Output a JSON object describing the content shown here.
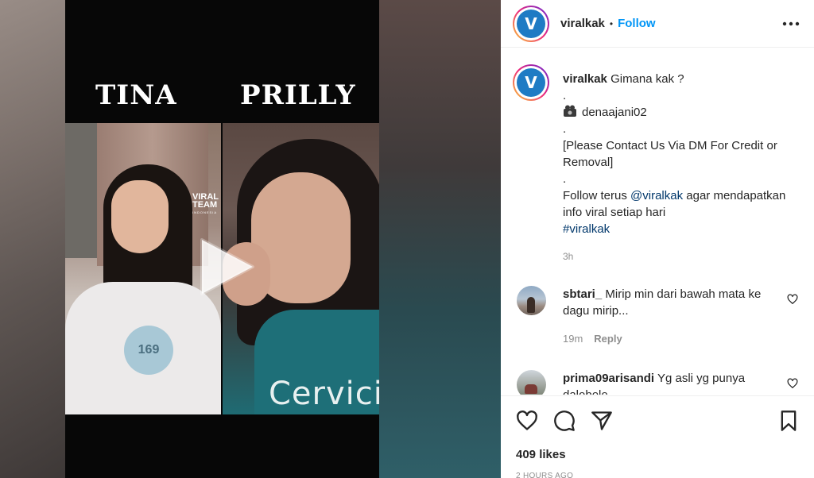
{
  "video": {
    "left_name": "TINA",
    "right_name": "PRILLY",
    "watermark_line1": "VIRAL",
    "watermark_line2": "TEAM",
    "watermark_line3": "INDONESIA",
    "shirt_left_text": "169",
    "shirt_right_text": "Cervici"
  },
  "header": {
    "username": "viralkak",
    "separator": "•",
    "follow_label": "Follow",
    "avatar_letter": "V"
  },
  "caption": {
    "username": "viralkak",
    "first_line": "Gimana kak ?",
    "dot": ".",
    "credit_handle": "denaajani02",
    "disclaimer": "[Please Contact Us Via DM For Credit or Removal]",
    "follow_prefix": "Follow terus ",
    "mention": "@viralkak",
    "follow_suffix": " agar mendapatkan info viral setiap hari",
    "hashtag": "#viralkak",
    "time": "3h"
  },
  "comments": [
    {
      "username": "sbtari_",
      "text": "Mirip min dari bawah mata ke dagu mirip...",
      "time": "19m",
      "reply_label": "Reply"
    },
    {
      "username": "prima09arisandi",
      "text": "Yg asli yg punya dalobolo",
      "time": "",
      "reply_label": ""
    }
  ],
  "footer": {
    "likes": "409 likes",
    "timestamp": "2 HOURS AGO"
  },
  "colors": {
    "accent": "#0095f6",
    "link": "#00376b",
    "muted": "#8e8e8e",
    "text": "#262626"
  }
}
